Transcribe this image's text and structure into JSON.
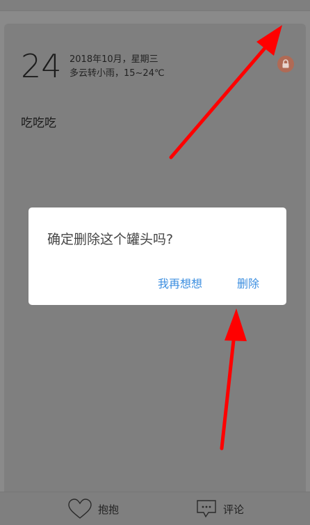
{
  "entry": {
    "day": "24",
    "date_line": "2018年10月，星期三",
    "weather_line": "多云转小雨，15~24℃",
    "text": "吃吃吃"
  },
  "dialog": {
    "message": "确定删除这个罐头吗?",
    "cancel_label": "我再想想",
    "confirm_label": "删除"
  },
  "bottom_bar": {
    "hug_label": "抱抱",
    "comment_label": "评论"
  },
  "colors": {
    "accent": "#3d8fe0",
    "lock_badge": "#b06a55",
    "arrow": "#ff0000"
  },
  "icons": [
    "lock-icon",
    "heart-icon",
    "comment-icon"
  ]
}
